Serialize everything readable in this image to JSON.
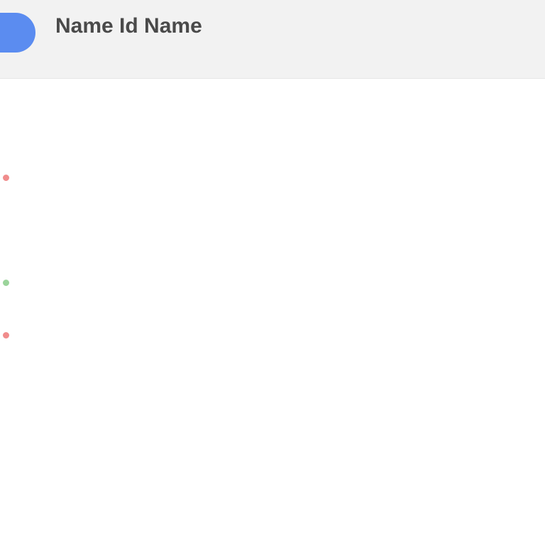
{
  "header": {
    "title": "Name Id Name",
    "subtitle": "",
    "corner_action": "",
    "avatar_color": "#5b8cf0"
  },
  "tabs": [
    {
      "label": ""
    },
    {
      "label": ""
    },
    {
      "label": ""
    },
    {
      "label": ""
    }
  ],
  "table": {
    "columns": [
      "",
      "",
      "",
      ""
    ],
    "rows": [
      {
        "name": "",
        "size": "",
        "date": "",
        "kind": "",
        "marker": "red-icon"
      },
      {
        "name": "",
        "size": "",
        "date": "",
        "kind": "",
        "marker": ""
      },
      {
        "name": "",
        "size": "",
        "date": "",
        "kind": "",
        "marker": ""
      },
      {
        "name": "",
        "size": "",
        "date": "",
        "kind": "",
        "marker": ""
      },
      {
        "name": "",
        "size": "",
        "date": "",
        "kind": "",
        "marker": "green-icon"
      },
      {
        "name": "",
        "size": "",
        "date": "",
        "kind": "",
        "marker": ""
      },
      {
        "name": "",
        "size": "",
        "date": "",
        "kind": "",
        "marker": "red-icon"
      },
      {
        "name": "",
        "size": "",
        "date": "",
        "kind": "",
        "marker": ""
      },
      {
        "name": "",
        "size": "",
        "date": "",
        "kind": "",
        "marker": ""
      },
      {
        "name": "",
        "size": "",
        "date": "",
        "kind": "",
        "marker": ""
      },
      {
        "name": "",
        "size": "",
        "date": "",
        "kind": "",
        "marker": ""
      },
      {
        "name": "",
        "size": "",
        "date": "",
        "kind": "",
        "marker": ""
      },
      {
        "name": "",
        "size": "",
        "date": "",
        "kind": "",
        "marker": ""
      },
      {
        "name": "",
        "size": "",
        "date": "",
        "kind": "",
        "marker": ""
      }
    ]
  },
  "colors": {
    "header_bg": "#f2f2f2",
    "accent": "#5b8cf0",
    "marker_red": "#f08c8c",
    "marker_green": "#9bd49b"
  }
}
